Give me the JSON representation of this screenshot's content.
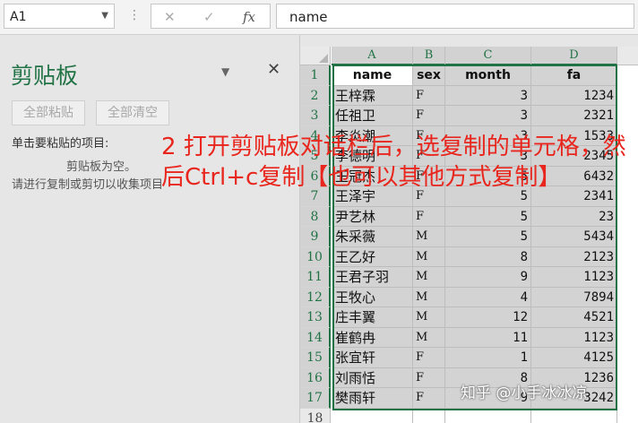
{
  "formula_bar": {
    "name_box": "A1",
    "cancel_icon": "✕",
    "confirm_icon": "✓",
    "fx_icon": "fx",
    "value": "name"
  },
  "clipboard": {
    "title": "剪贴板",
    "paste_all": "全部粘贴",
    "clear_all": "全部清空",
    "instruction": "单击要粘贴的项目:",
    "empty_text": "剪贴板为空。",
    "hint": "请进行复制或剪切以收集项目"
  },
  "sheet": {
    "columns": [
      "A",
      "B",
      "C",
      "D"
    ],
    "rows": [
      "1",
      "2",
      "3",
      "4",
      "5",
      "6",
      "7",
      "8",
      "9",
      "10",
      "11",
      "12",
      "13",
      "14",
      "15",
      "16",
      "17",
      "18"
    ],
    "headers": [
      "name",
      "sex",
      "month",
      "fa"
    ],
    "data": [
      [
        "王梓霖",
        "F",
        "3",
        "1234"
      ],
      [
        "任祖卫",
        "F",
        "3",
        "2321"
      ],
      [
        "李炎潮",
        "F",
        "3",
        "1533"
      ],
      [
        "李德明",
        "F",
        "3",
        "2345"
      ],
      [
        "王冠杰",
        "F",
        "5",
        "6432"
      ],
      [
        "王泽宇",
        "F",
        "5",
        "2341"
      ],
      [
        "尹艺林",
        "F",
        "5",
        "23"
      ],
      [
        "朱采薇",
        "M",
        "5",
        "5434"
      ],
      [
        "王乙好",
        "M",
        "8",
        "2123"
      ],
      [
        "王君子羽",
        "M",
        "9",
        "1123"
      ],
      [
        "王牧心",
        "M",
        "4",
        "7894"
      ],
      [
        "庄丰翼",
        "M",
        "12",
        "4521"
      ],
      [
        "崔鹤冉",
        "M",
        "11",
        "1123"
      ],
      [
        "张宜轩",
        "F",
        "1",
        "4125"
      ],
      [
        "刘雨恬",
        "F",
        "8",
        "1236"
      ],
      [
        "樊雨轩",
        "F",
        "9",
        "3242"
      ]
    ]
  },
  "annotation": "2 打开剪贴板对话栏后，选复制的单元格，然后Ctrl+c复制【也可以其他方式复制】",
  "watermark": "知乎 @小手冰冰凉",
  "colors": {
    "accent": "#217346",
    "annotation": "#e8261d"
  }
}
